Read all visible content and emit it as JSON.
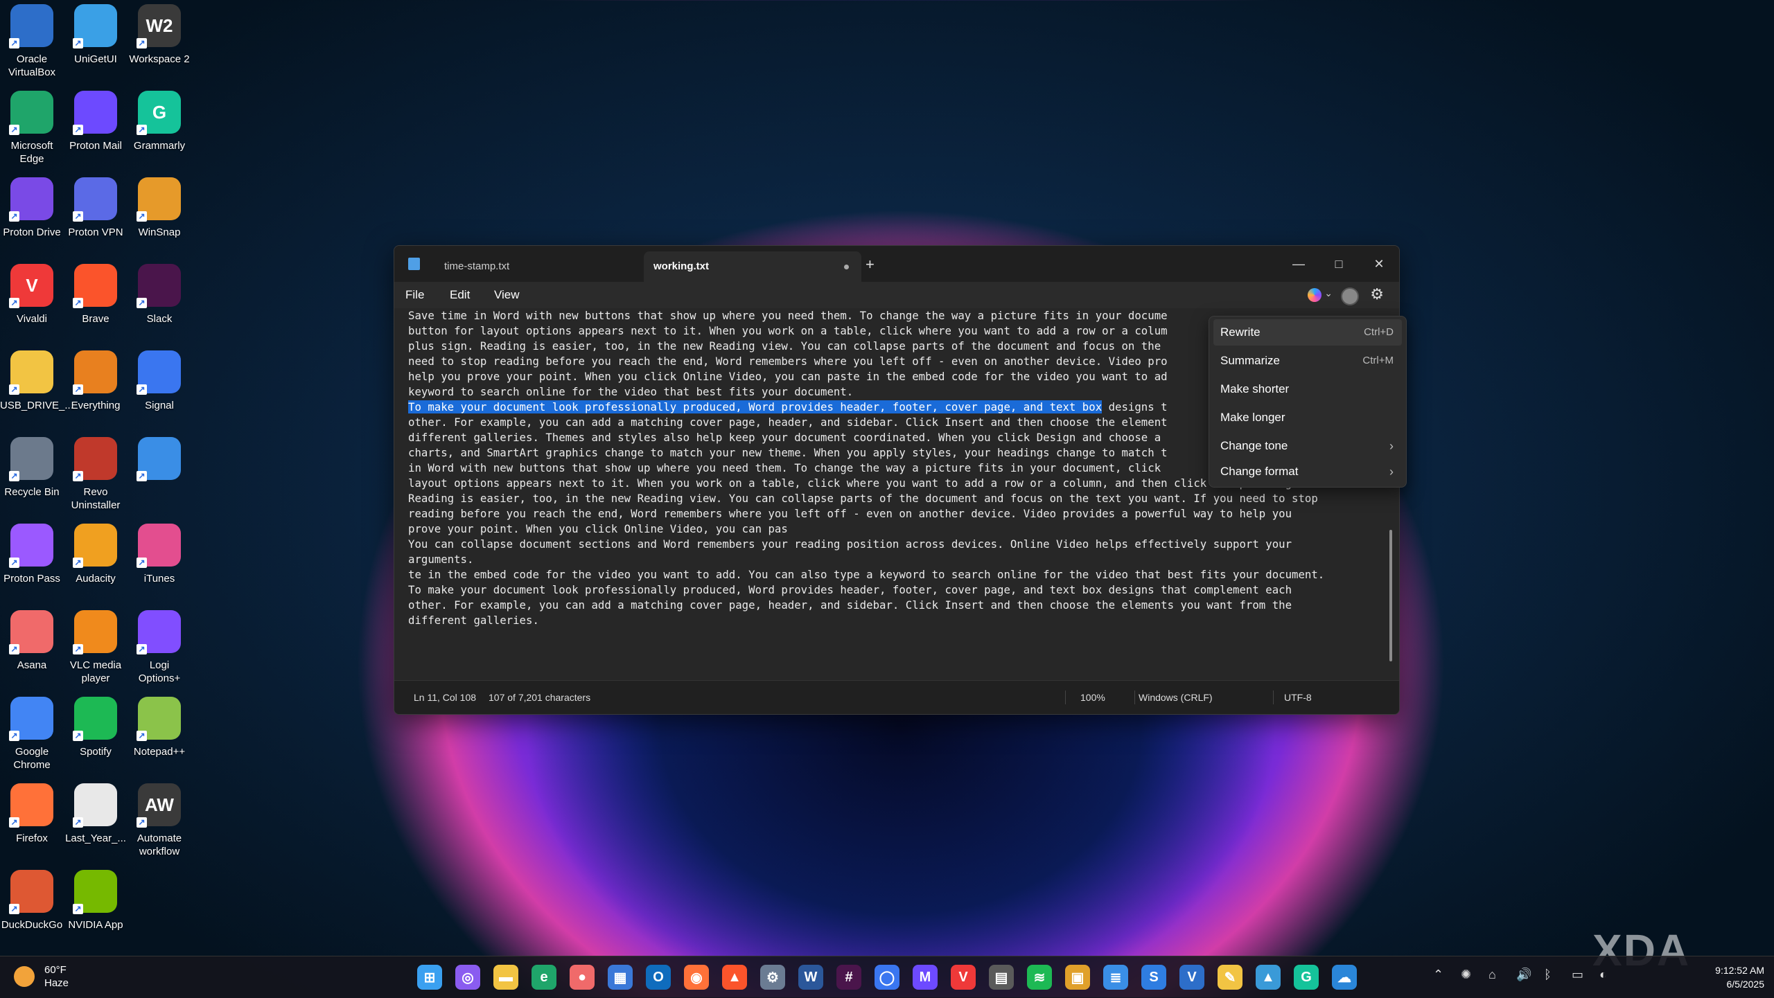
{
  "desktop": {
    "icons": [
      {
        "label": "Oracle VirtualBox",
        "icon": "virtualbox-icon",
        "color": "#2d6ec9"
      },
      {
        "label": "UniGetUI",
        "icon": "unigetui-icon",
        "color": "#3aa0e6"
      },
      {
        "label": "Workspace 2",
        "icon": "workspace-icon",
        "color": "#3a3a3a",
        "glyph": "W2"
      },
      {
        "label": "Microsoft Edge",
        "icon": "edge-icon",
        "color": "#1fa56a"
      },
      {
        "label": "Proton Mail",
        "icon": "protonmail-icon",
        "color": "#6d4aff"
      },
      {
        "label": "Grammarly",
        "icon": "grammarly-icon",
        "color": "#15c39a",
        "glyph": "G"
      },
      {
        "label": "Proton Drive",
        "icon": "protondrive-icon",
        "color": "#7a4ae6"
      },
      {
        "label": "Proton VPN",
        "icon": "protonvpn-icon",
        "color": "#5b6ae6"
      },
      {
        "label": "WinSnap",
        "icon": "winsnap-icon",
        "color": "#e69a2a"
      },
      {
        "label": "Vivaldi",
        "icon": "vivaldi-icon",
        "color": "#ef3939",
        "glyph": "V"
      },
      {
        "label": "Brave",
        "icon": "brave-icon",
        "color": "#fb542b"
      },
      {
        "label": "Slack",
        "icon": "slack-icon",
        "color": "#4a154b"
      },
      {
        "label": "USB_DRIVE_...",
        "icon": "folder-icon",
        "color": "#f2c443"
      },
      {
        "label": "Everything",
        "icon": "everything-icon",
        "color": "#e8801f"
      },
      {
        "label": "Signal",
        "icon": "signal-icon",
        "color": "#3a76f0"
      },
      {
        "label": "Recycle Bin",
        "icon": "recycle-bin-icon",
        "color": "#6c7a8c"
      },
      {
        "label": "Revo Uninstaller",
        "icon": "revo-icon",
        "color": "#c0392b"
      },
      {
        "label": "",
        "icon": "control-panel-icon",
        "color": "#3a8ee6"
      },
      {
        "label": "Proton Pass",
        "icon": "protonpass-icon",
        "color": "#9b59ff"
      },
      {
        "label": "Audacity",
        "icon": "audacity-icon",
        "color": "#f0a020"
      },
      {
        "label": "iTunes",
        "icon": "itunes-icon",
        "color": "#e34e8f"
      },
      {
        "label": "Asana",
        "icon": "asana-icon",
        "color": "#f06a6a"
      },
      {
        "label": "VLC media player",
        "icon": "vlc-icon",
        "color": "#f08a1c"
      },
      {
        "label": "Logi Options+",
        "icon": "logi-icon",
        "color": "#814eff"
      },
      {
        "label": "Google Chrome",
        "icon": "chrome-icon",
        "color": "#4285f4"
      },
      {
        "label": "Spotify",
        "icon": "spotify-icon",
        "color": "#1db954"
      },
      {
        "label": "Notepad++",
        "icon": "notepadpp-icon",
        "color": "#8bc34a"
      },
      {
        "label": "Firefox",
        "icon": "firefox-icon",
        "color": "#ff7139"
      },
      {
        "label": "Last_Year_...",
        "icon": "document-icon",
        "color": "#e8e8e8"
      },
      {
        "label": "Automate workflow",
        "icon": "automate-icon",
        "color": "#3a3a3a",
        "glyph": "AW"
      },
      {
        "label": "DuckDuckGo",
        "icon": "duckduckgo-icon",
        "color": "#de5833"
      },
      {
        "label": "NVIDIA App",
        "icon": "nvidia-icon",
        "color": "#76b900"
      }
    ]
  },
  "window": {
    "tabs": [
      {
        "label": "time-stamp.txt"
      },
      {
        "label": "working.txt"
      }
    ],
    "new_tab": "+",
    "controls": {
      "minimize": "—",
      "maximize": "□",
      "close": "✕"
    },
    "menu": {
      "file": "File",
      "edit": "Edit",
      "view": "View"
    },
    "status": {
      "position": "Ln 11, Col 108",
      "chars": "107 of 7,201 characters",
      "zoom": "100%",
      "line_ending": "Windows (CRLF)",
      "encoding": "UTF-8"
    }
  },
  "editor": {
    "lines": [
      "Save time in Word with new buttons that show up where you need them. To change the way a picture fits in your docume",
      "button for layout options appears next to it. When you work on a table, click where you want to add a row or a colum",
      "plus sign. Reading is easier, too, in the new Reading view. You can collapse parts of the document and focus on the ",
      "need to stop reading before you reach the end, Word remembers where you left off - even on another device. Video pro",
      "help you prove your point. When you click Online Video, you can paste in the embed code for the video you want to ad",
      "keyword to search online for the video that best fits your document."
    ],
    "selected": "To make your document look professionally produced, Word provides header, footer, cover page, and text box",
    "selected_rest": " designs t",
    "lines2": [
      "other. For example, you can add a matching cover page, header, and sidebar. Click Insert and then choose the element",
      "different galleries. Themes and styles also help keep your document coordinated. When you click Design and choose a ",
      "charts, and SmartArt graphics change to match your new theme. When you apply styles, your headings change to match t",
      "in Word with new buttons that show up where you need them. To change the way a picture fits in your document, click ",
      "layout options appears next to it. When you work on a table, click where you want to add a row or a column, and then click the plus sign.",
      "Reading is easier, too, in the new Reading view. You can collapse parts of the document and focus on the text you want. If you need to stop",
      "reading before you reach the end, Word remembers where you left off - even on another device. Video provides a powerful way to help you",
      "prove your point. When you click Online Video, you can pas",
      "You can collapse document sections and Word remembers your reading position across devices. Online Video helps effectively support your",
      "arguments.",
      "te in the embed code for the video you want to add. You can also type a keyword to search online for the video that best fits your document.",
      "To make your document look professionally produced, Word provides header, footer, cover page, and text box designs that complement each",
      "other. For example, you can add a matching cover page, header, and sidebar. Click Insert and then choose the elements you want from the",
      "different galleries."
    ]
  },
  "context_menu": {
    "items": [
      {
        "label": "Rewrite",
        "shortcut": "Ctrl+D"
      },
      {
        "label": "Summarize",
        "shortcut": "Ctrl+M"
      },
      {
        "label": "Make shorter",
        "shortcut": ""
      },
      {
        "label": "Make longer",
        "shortcut": ""
      },
      {
        "label": "Change tone",
        "shortcut": "›"
      },
      {
        "label": "Change format",
        "shortcut": "›"
      }
    ]
  },
  "taskbar": {
    "weather": {
      "temp": "60°F",
      "condition": "Haze"
    },
    "apps": [
      {
        "icon": "start-icon",
        "color": "#3aa0f0",
        "glyph": "⊞"
      },
      {
        "icon": "copilot-icon",
        "color": "#8a5cf0",
        "glyph": "◎"
      },
      {
        "icon": "file-explorer-icon",
        "color": "#f2c443",
        "glyph": "▬"
      },
      {
        "icon": "edge-icon",
        "color": "#1fa56a",
        "glyph": "e"
      },
      {
        "icon": "asana-icon",
        "color": "#f06a6a",
        "glyph": "●"
      },
      {
        "icon": "store-icon",
        "color": "#3a78d8",
        "glyph": "▦"
      },
      {
        "icon": "outlook-icon",
        "color": "#0f6cbd",
        "glyph": "O"
      },
      {
        "icon": "firefox-icon",
        "color": "#ff7139",
        "glyph": "◉"
      },
      {
        "icon": "brave-icon",
        "color": "#fb542b",
        "glyph": "▲"
      },
      {
        "icon": "settings-icon",
        "color": "#6b7c93",
        "glyph": "⚙"
      },
      {
        "icon": "word-icon",
        "color": "#2b579a",
        "glyph": "W"
      },
      {
        "icon": "slack-icon",
        "color": "#4a154b",
        "glyph": "#"
      },
      {
        "icon": "signal-icon",
        "color": "#3a76f0",
        "glyph": "◯"
      },
      {
        "icon": "protonmail-icon",
        "color": "#6d4aff",
        "glyph": "M"
      },
      {
        "icon": "vivaldi-icon",
        "color": "#ef3939",
        "glyph": "V"
      },
      {
        "icon": "calculator-icon",
        "color": "#5a5a5a",
        "glyph": "▤"
      },
      {
        "icon": "spotify-icon",
        "color": "#1db954",
        "glyph": "≋"
      },
      {
        "icon": "media-icon",
        "color": "#e0a02a",
        "glyph": "▣"
      },
      {
        "icon": "notepad-icon",
        "color": "#3a8ee6",
        "glyph": "≣"
      },
      {
        "icon": "swiftkey-icon",
        "color": "#2f7de1",
        "glyph": "S"
      },
      {
        "icon": "virtualbox-icon",
        "color": "#2d6ec9",
        "glyph": "V"
      },
      {
        "icon": "notes-icon",
        "color": "#f2c443",
        "glyph": "✎"
      },
      {
        "icon": "photos-icon",
        "color": "#3a9ad8",
        "glyph": "▲"
      },
      {
        "icon": "grammarly-icon",
        "color": "#15c39a",
        "glyph": "G"
      },
      {
        "icon": "onedrive-icon",
        "color": "#2a86d8",
        "glyph": "☁"
      }
    ],
    "clock": {
      "time": "9:12:52 AM",
      "date": "6/5/2025"
    }
  },
  "watermark": "XDA"
}
